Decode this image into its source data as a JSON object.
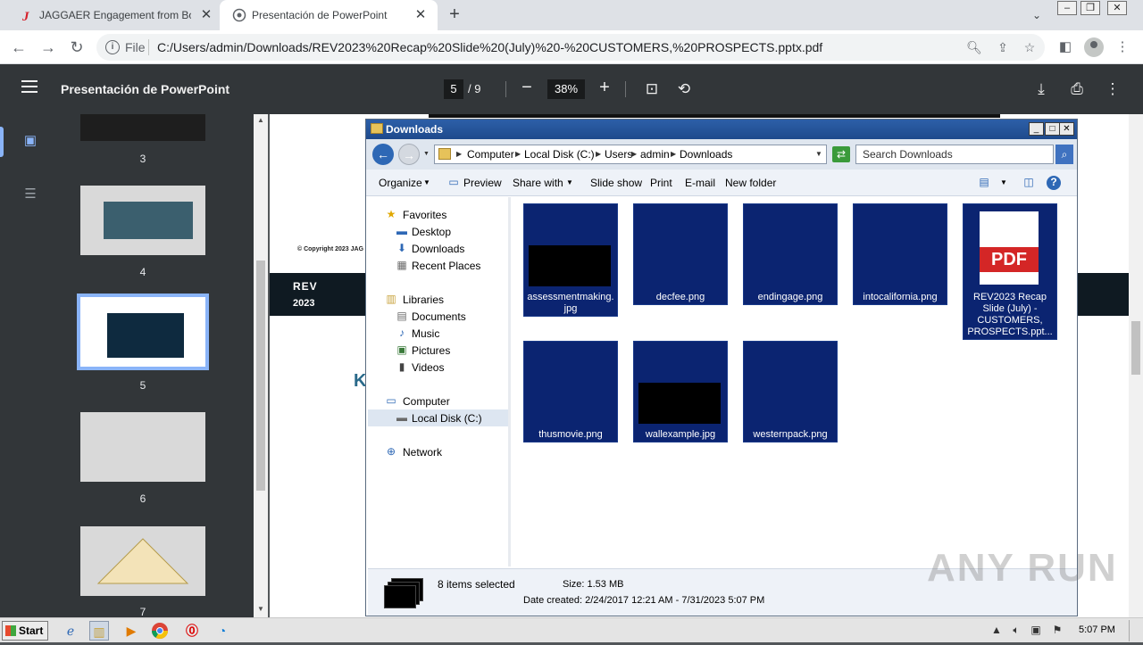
{
  "browser": {
    "tabs": [
      {
        "title": "JAGGAER Engagement from Bojana",
        "active": false
      },
      {
        "title": "Presentación de PowerPoint",
        "active": true
      }
    ],
    "address": {
      "scheme": "File",
      "url": "C:/Users/admin/Downloads/REV2023%20Recap%20Slide%20(July)%20-%20CUSTOMERS,%20PROSPECTS.pptx.pdf"
    }
  },
  "pdf_viewer": {
    "title": "Presentación de PowerPoint",
    "current_page": "5",
    "total_pages": "/  9",
    "zoom": "38%",
    "thumbnails": [
      {
        "label": "3"
      },
      {
        "label": "4"
      },
      {
        "label": "5",
        "selected": true
      },
      {
        "label": "6"
      },
      {
        "label": "7"
      }
    ],
    "page_text": {
      "copyright": "© Copyright 2023 JAG",
      "rev": "REV",
      "year": "2023",
      "big_letter": "K"
    }
  },
  "explorer": {
    "title": "Downloads",
    "breadcrumb": [
      "Computer",
      "Local Disk (C:)",
      "Users",
      "admin",
      "Downloads"
    ],
    "search_placeholder": "Search Downloads",
    "commands": [
      "Organize",
      "Preview",
      "Share with",
      "Slide show",
      "Print",
      "E-mail",
      "New folder"
    ],
    "nav": {
      "favorites": "Favorites",
      "favorite_items": [
        "Desktop",
        "Downloads",
        "Recent Places"
      ],
      "libraries": "Libraries",
      "library_items": [
        "Documents",
        "Music",
        "Pictures",
        "Videos"
      ],
      "computer": "Computer",
      "local_disk": "Local Disk (C:)",
      "network": "Network"
    },
    "files": [
      {
        "name": "assessmentmaking.\njpg"
      },
      {
        "name": "decfee.png"
      },
      {
        "name": "endingage.png"
      },
      {
        "name": "intocalifornia.png"
      },
      {
        "name": "REV2023 Recap Slide (July) - CUSTOMERS, PROSPECTS.ppt..."
      },
      {
        "name": "thusmovie.png"
      },
      {
        "name": "wallexample.jpg"
      },
      {
        "name": "westernpack.png"
      }
    ],
    "pdf_badge": "PDF",
    "status": {
      "selected": "8 items selected",
      "size": "Size: 1.53 MB",
      "date_created": "Date created: 2/24/2017 12:21 AM - 7/31/2023 5:07 PM"
    }
  },
  "taskbar": {
    "start": "Start",
    "clock": "5:07 PM"
  },
  "watermark": "ANY RUN"
}
